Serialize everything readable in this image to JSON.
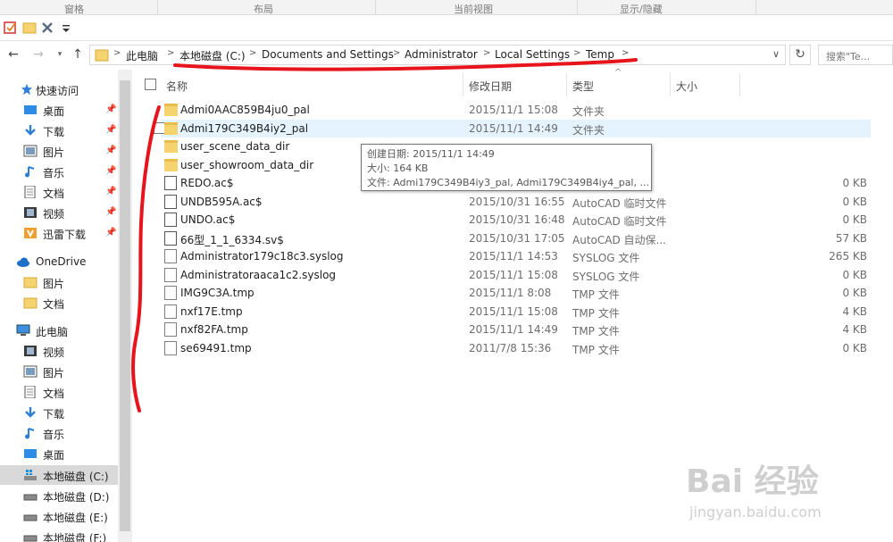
{
  "ribbon": {
    "groups": [
      "窗格",
      "布局",
      "当前视图",
      "显示/隐藏"
    ]
  },
  "address": {
    "crumbs": [
      "此电脑",
      "本地磁盘 (C:)",
      "Documents and Settings",
      "Administrator",
      "Local Settings",
      "Temp"
    ],
    "search_placeholder": "搜索\"Te..."
  },
  "nav": {
    "quick_access": "快速访问",
    "items": [
      {
        "label": "桌面",
        "icon": "desktop-icon",
        "pinned": true
      },
      {
        "label": "下载",
        "icon": "download-icon",
        "pinned": true
      },
      {
        "label": "图片",
        "icon": "pictures-icon",
        "pinned": true
      },
      {
        "label": "音乐",
        "icon": "music-icon",
        "pinned": true
      },
      {
        "label": "文档",
        "icon": "documents-icon",
        "pinned": true
      },
      {
        "label": "视频",
        "icon": "videos-icon",
        "pinned": true
      },
      {
        "label": "迅雷下载",
        "icon": "xunlei-icon",
        "pinned": true
      }
    ],
    "onedrive": "OneDrive",
    "onedrive_items": [
      "图片",
      "文档"
    ],
    "this_pc": "此电脑",
    "pc_items": [
      "视频",
      "图片",
      "文档",
      "下载",
      "音乐",
      "桌面"
    ],
    "drives": [
      "本地磁盘 (C:)",
      "本地磁盘 (D:)",
      "本地磁盘 (E:)",
      "本地磁盘 (F:)"
    ]
  },
  "columns": {
    "name": "名称",
    "date": "修改日期",
    "type": "类型",
    "size": "大小"
  },
  "files": [
    {
      "name": "Admi0AAC859B4ju0_pal",
      "date": "2015/11/1 15:08",
      "type": "文件夹",
      "size": "",
      "kind": "folder"
    },
    {
      "name": "Admi179C349B4iy2_pal",
      "date": "2015/11/1 14:49",
      "type": "文件夹",
      "size": "",
      "kind": "folder"
    },
    {
      "name": "user_scene_data_dir",
      "date": "",
      "type": "",
      "size": "",
      "kind": "folder"
    },
    {
      "name": "user_showroom_data_dir",
      "date": "",
      "type": "",
      "size": "",
      "kind": "folder"
    },
    {
      "name": "REDO.ac$",
      "date": "",
      "type": "",
      "size": "0 KB",
      "kind": "cad"
    },
    {
      "name": "UNDB595A.ac$",
      "date": "2015/10/31 16:55",
      "type": "AutoCAD 临时文件",
      "size": "0 KB",
      "kind": "cad"
    },
    {
      "name": "UNDO.ac$",
      "date": "2015/10/31 16:48",
      "type": "AutoCAD 临时文件",
      "size": "0 KB",
      "kind": "cad"
    },
    {
      "name": "66型_1_1_6334.sv$",
      "date": "2015/10/31 17:05",
      "type": "AutoCAD 自动保...",
      "size": "57 KB",
      "kind": "cad"
    },
    {
      "name": "Administrator179c18c3.syslog",
      "date": "2015/11/1 14:53",
      "type": "SYSLOG 文件",
      "size": "265 KB",
      "kind": "doc"
    },
    {
      "name": "Administratoraaca1c2.syslog",
      "date": "2015/11/1 15:08",
      "type": "SYSLOG 文件",
      "size": "0 KB",
      "kind": "doc"
    },
    {
      "name": "IMG9C3A.tmp",
      "date": "2015/11/1 8:08",
      "type": "TMP 文件",
      "size": "0 KB",
      "kind": "doc"
    },
    {
      "name": "nxf17E.tmp",
      "date": "2015/11/1 15:08",
      "type": "TMP 文件",
      "size": "4 KB",
      "kind": "doc"
    },
    {
      "name": "nxf82FA.tmp",
      "date": "2015/11/1 14:49",
      "type": "TMP 文件",
      "size": "4 KB",
      "kind": "doc"
    },
    {
      "name": "se69491.tmp",
      "date": "2011/7/8 15:36",
      "type": "TMP 文件",
      "size": "0 KB",
      "kind": "doc"
    }
  ],
  "tooltip": {
    "line1": "创建日期: 2015/11/1 14:49",
    "line2": "大小: 164 KB",
    "line3": "文件: Admi179C349B4iy3_pal, Admi179C349B4iy4_pal, ..."
  },
  "watermark": {
    "brand": "Bai 经验",
    "url": "jingyan.baidu.com"
  },
  "colors": {
    "accent": "#0078d7",
    "highlight": "#e5f3ff",
    "folder": "#f5d36f",
    "annotation": "#e8141b"
  }
}
